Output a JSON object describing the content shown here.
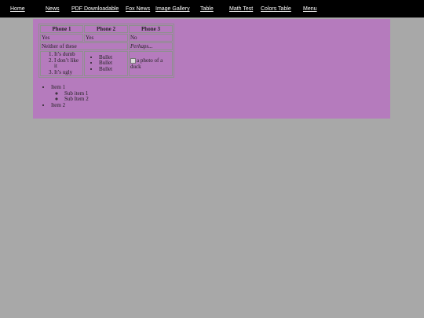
{
  "nav": {
    "items": [
      {
        "label": "Home"
      },
      {
        "label": "News"
      },
      {
        "label": "PDF Downloadable"
      },
      {
        "label": "Fox News"
      },
      {
        "label": "Image Gallery"
      },
      {
        "label": "Table"
      },
      {
        "label": "Math Test"
      },
      {
        "label": "Colors Table"
      },
      {
        "label": "Menu"
      }
    ]
  },
  "table": {
    "headers": [
      "Phone 1",
      "Phone 2",
      "Phone 3"
    ],
    "row1": [
      "Yes",
      "Yes",
      "No"
    ],
    "row2": {
      "merged": "Neither of these",
      "last": "Perhaps..."
    },
    "ordered_list": [
      "It’s dumb",
      "I don’t like it",
      "It’s ugly"
    ],
    "bullets": [
      "Bullet",
      "Bullet",
      "Bullet"
    ],
    "image_alt": "a photo of a duck"
  },
  "tree": {
    "item1": "Item 1",
    "subitems": [
      "Sub item 1",
      "Sub Item 2"
    ],
    "item2": "Item 2"
  },
  "colors": {
    "page_bg": "#a8a8a8",
    "navbar_bg": "#000000",
    "panel_bg": "#b57bbd",
    "nav_link": "#ffffff"
  }
}
